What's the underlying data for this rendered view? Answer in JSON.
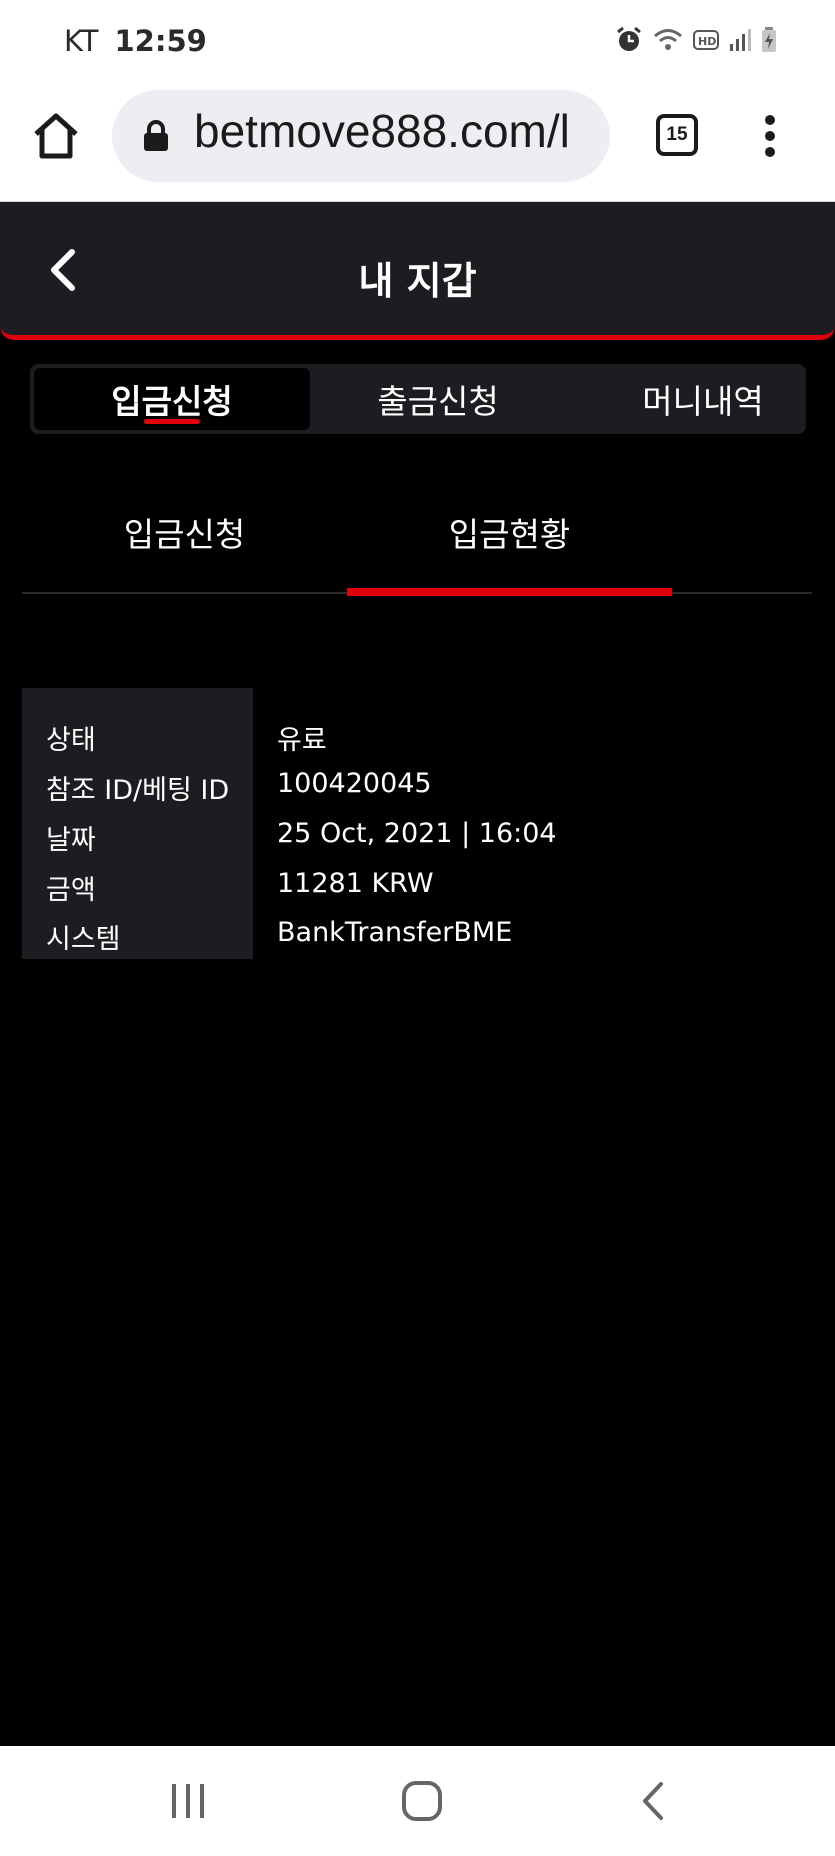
{
  "status_bar": {
    "carrier": "KT",
    "time": "12:59",
    "icons": [
      "alarm-icon",
      "wifi-icon",
      "hd-voice-icon",
      "signal-icon",
      "battery-charging-icon"
    ]
  },
  "browser": {
    "url": "betmove888.com/l",
    "tab_count": "15",
    "icons": [
      "home-icon",
      "lock-icon",
      "tabs-icon",
      "more-vert-icon"
    ]
  },
  "header": {
    "title": "내 지갑",
    "back_icon": "chevron-left-icon"
  },
  "top_tabs": [
    {
      "label": "입금신청",
      "active": true
    },
    {
      "label": "출금신청",
      "active": false
    },
    {
      "label": "머니내역",
      "active": false
    }
  ],
  "sub_tabs": [
    {
      "label": "입금신청",
      "active": false
    },
    {
      "label": "입금현황",
      "active": true
    }
  ],
  "details": [
    {
      "label": "상태",
      "value": "유료"
    },
    {
      "label": "참조 ID/베팅 ID",
      "value": "100420045"
    },
    {
      "label": "날짜",
      "value": "25 Oct, 2021 | 16:04"
    },
    {
      "label": "금액",
      "value": "11281 KRW"
    },
    {
      "label": "시스템",
      "value": "BankTransferBME"
    }
  ],
  "nav_bar": {
    "icons": [
      "recent-apps-icon",
      "home-circle-icon",
      "back-icon"
    ]
  },
  "colors": {
    "accent": "#e0000b",
    "panel": "#1d1d21",
    "background": "#000000"
  }
}
